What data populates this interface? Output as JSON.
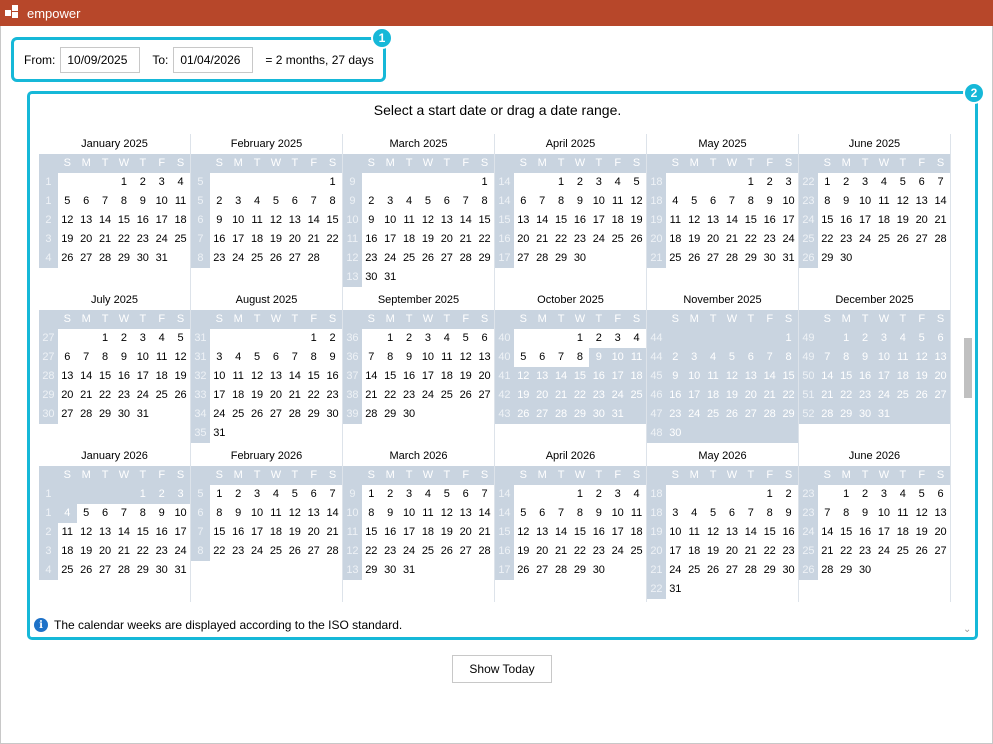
{
  "window": {
    "title": "empower"
  },
  "range": {
    "from_label": "From:",
    "from_value": "10/09/2025",
    "to_label": "To:",
    "to_value": "01/04/2026",
    "duration": "= 2 months, 27 days",
    "badge": "1"
  },
  "calendar": {
    "badge": "2",
    "title": "Select a start date or drag a date range.",
    "weekday_headers": [
      "S",
      "M",
      "T",
      "W",
      "T",
      "F",
      "S"
    ],
    "info_text": "The calendar weeks are displayed according to the ISO standard.",
    "selection": {
      "start": "2025-10-09",
      "end": "2026-01-04"
    },
    "months": [
      {
        "name": "January 2025",
        "year": 2025,
        "month": 1
      },
      {
        "name": "February 2025",
        "year": 2025,
        "month": 2
      },
      {
        "name": "March 2025",
        "year": 2025,
        "month": 3
      },
      {
        "name": "April 2025",
        "year": 2025,
        "month": 4
      },
      {
        "name": "May 2025",
        "year": 2025,
        "month": 5
      },
      {
        "name": "June 2025",
        "year": 2025,
        "month": 6
      },
      {
        "name": "July 2025",
        "year": 2025,
        "month": 7
      },
      {
        "name": "August 2025",
        "year": 2025,
        "month": 8
      },
      {
        "name": "September 2025",
        "year": 2025,
        "month": 9
      },
      {
        "name": "October 2025",
        "year": 2025,
        "month": 10
      },
      {
        "name": "November 2025",
        "year": 2025,
        "month": 11
      },
      {
        "name": "December 2025",
        "year": 2025,
        "month": 12
      },
      {
        "name": "January 2026",
        "year": 2026,
        "month": 1
      },
      {
        "name": "February 2026",
        "year": 2026,
        "month": 2
      },
      {
        "name": "March 2026",
        "year": 2026,
        "month": 3
      },
      {
        "name": "April 2026",
        "year": 2026,
        "month": 4
      },
      {
        "name": "May 2026",
        "year": 2026,
        "month": 5
      },
      {
        "name": "June 2026",
        "year": 2026,
        "month": 6
      }
    ]
  },
  "footer": {
    "show_today_label": "Show Today"
  },
  "colors": {
    "accent": "#16b8d8",
    "titlebar": "#b7472a",
    "selection": "#c9d4e0"
  }
}
